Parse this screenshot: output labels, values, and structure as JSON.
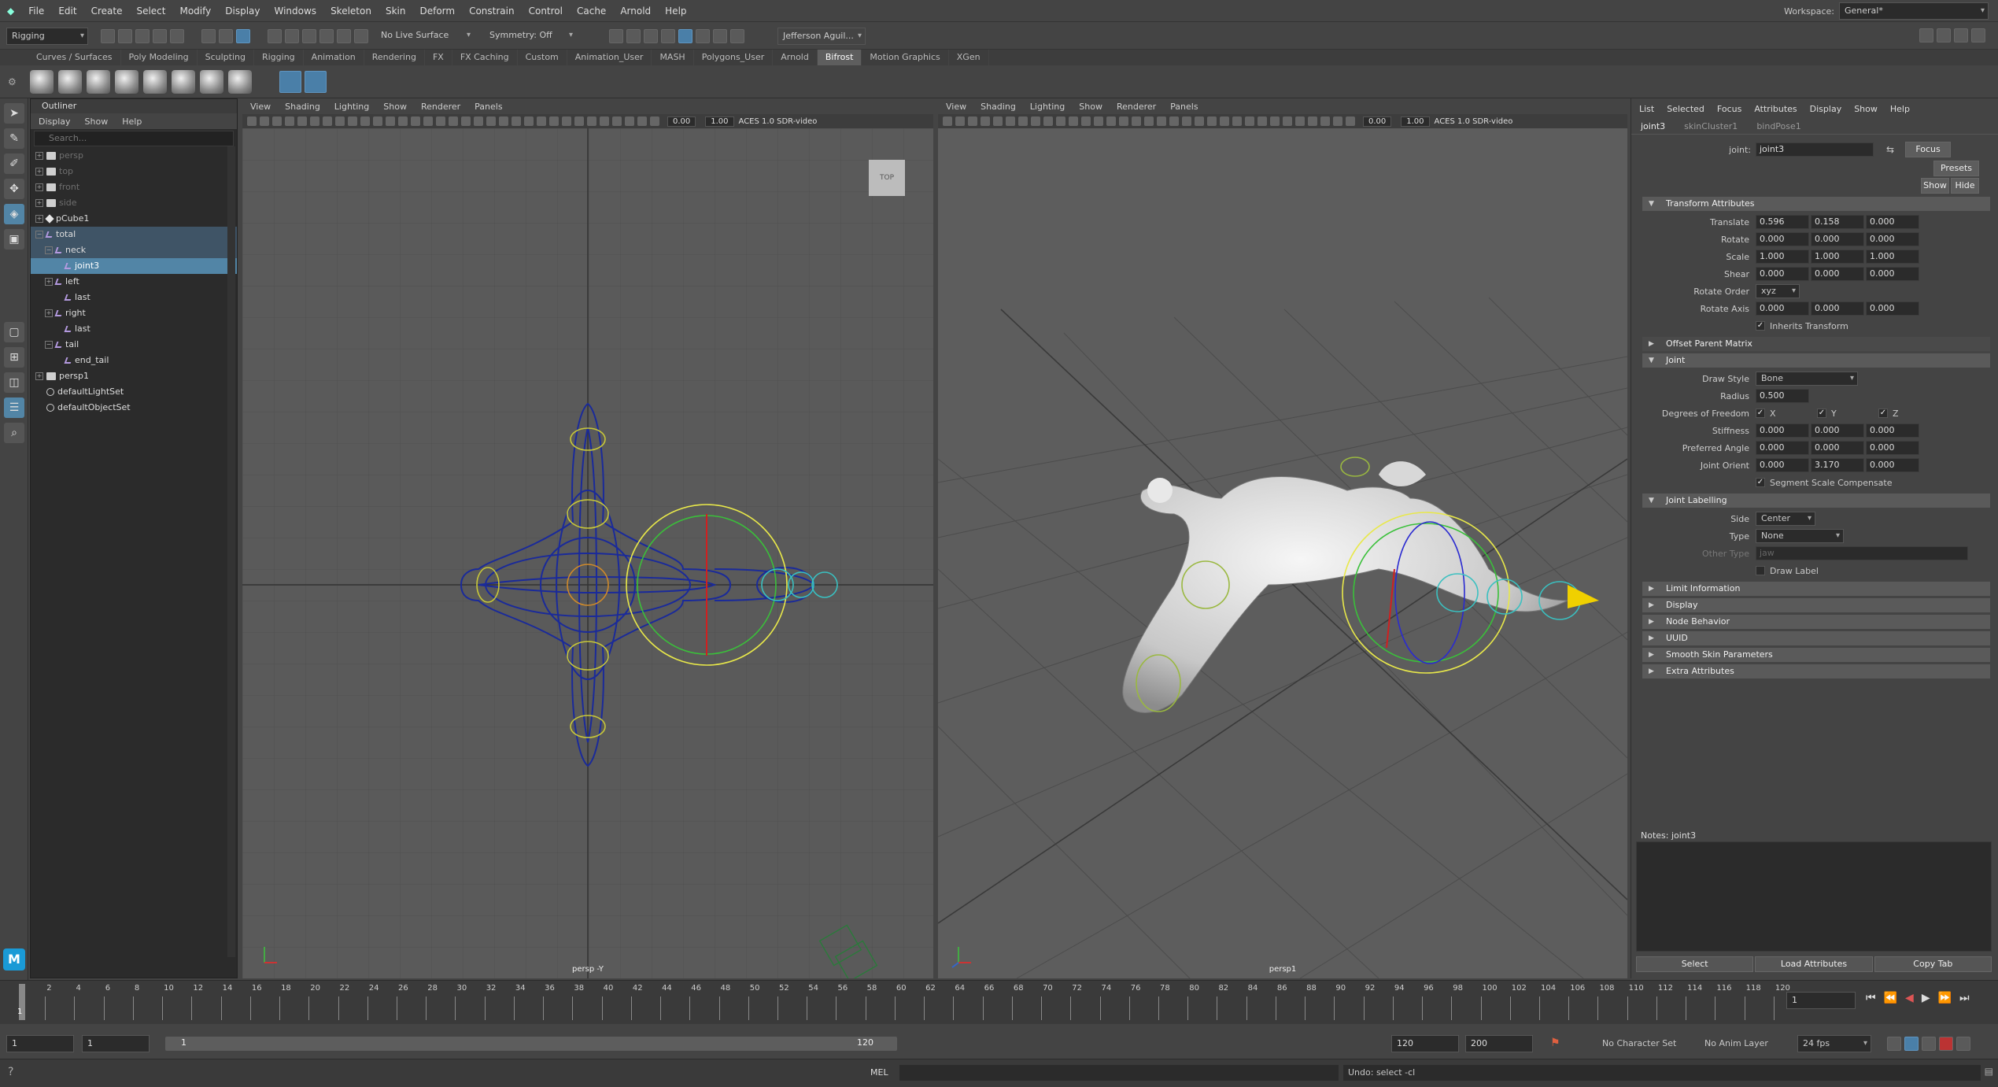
{
  "menubar": {
    "items": [
      "File",
      "Edit",
      "Create",
      "Select",
      "Modify",
      "Display",
      "Windows",
      "Skeleton",
      "Skin",
      "Deform",
      "Constrain",
      "Control",
      "Cache",
      "Arnold",
      "Help"
    ],
    "workspace_label": "Workspace:",
    "workspace_value": "General*"
  },
  "statusline": {
    "menuset": "Rigging",
    "live_surface": "No Live Surface",
    "symmetry": "Symmetry: Off",
    "user": "Jefferson Aguil..."
  },
  "shelf": {
    "tabs": [
      "Curves / Surfaces",
      "Poly Modeling",
      "Sculpting",
      "Rigging",
      "Animation",
      "Rendering",
      "FX",
      "FX Caching",
      "Custom",
      "Animation_User",
      "MASH",
      "Polygons_User",
      "Arnold",
      "Bifrost",
      "Motion Graphics",
      "XGen"
    ],
    "active_tab": "Bifrost"
  },
  "outliner": {
    "title": "Outliner",
    "menu": [
      "Display",
      "Show",
      "Help"
    ],
    "search_placeholder": "Search...",
    "nodes": [
      {
        "label": "persp",
        "type": "cam",
        "indent": 0,
        "dim": true
      },
      {
        "label": "top",
        "type": "cam",
        "indent": 0,
        "dim": true
      },
      {
        "label": "front",
        "type": "cam",
        "indent": 0,
        "dim": true
      },
      {
        "label": "side",
        "type": "cam",
        "indent": 0,
        "dim": true
      },
      {
        "label": "pCube1",
        "type": "mesh",
        "indent": 0,
        "dim": false
      },
      {
        "label": "total",
        "type": "jt",
        "indent": 0,
        "dim": false,
        "state": "sel2"
      },
      {
        "label": "neck",
        "type": "jt",
        "indent": 1,
        "dim": false,
        "state": "sel2"
      },
      {
        "label": "joint3",
        "type": "jt",
        "indent": 2,
        "dim": false,
        "state": "sel"
      },
      {
        "label": "left",
        "type": "jt",
        "indent": 1,
        "dim": false
      },
      {
        "label": "last",
        "type": "jt",
        "indent": 2,
        "dim": false
      },
      {
        "label": "right",
        "type": "jt",
        "indent": 1,
        "dim": false
      },
      {
        "label": "last",
        "type": "jt",
        "indent": 2,
        "dim": false
      },
      {
        "label": "tail",
        "type": "jt",
        "indent": 1,
        "dim": false
      },
      {
        "label": "end_tail",
        "type": "jt",
        "indent": 2,
        "dim": false
      },
      {
        "label": "persp1",
        "type": "cam",
        "indent": 0,
        "dim": false
      },
      {
        "label": "defaultLightSet",
        "type": "set",
        "indent": 0,
        "dim": false
      },
      {
        "label": "defaultObjectSet",
        "type": "set",
        "indent": 0,
        "dim": false
      }
    ]
  },
  "viewport_left": {
    "menu": [
      "View",
      "Shading",
      "Lighting",
      "Show",
      "Renderer",
      "Panels"
    ],
    "exposure": "0.00",
    "gamma": "1.00",
    "colorspace": "ACES 1.0 SDR-video",
    "cube_label": "TOP",
    "camera_label": "persp -Y"
  },
  "viewport_right": {
    "menu": [
      "View",
      "Shading",
      "Lighting",
      "Show",
      "Renderer",
      "Panels"
    ],
    "exposure": "0.00",
    "gamma": "1.00",
    "colorspace": "ACES 1.0 SDR-video",
    "camera_label": "persp1"
  },
  "attribute_editor": {
    "menu": [
      "List",
      "Selected",
      "Focus",
      "Attributes",
      "Display",
      "Show",
      "Help"
    ],
    "tabs": [
      "joint3",
      "skinCluster1",
      "bindPose1"
    ],
    "joint_label": "joint:",
    "joint_name": "joint3",
    "focus_btn": "Focus",
    "presets_btn": "Presets",
    "show_btn": "Show",
    "hide_btn": "Hide",
    "transform_section": "Transform Attributes",
    "translate_label": "Translate",
    "translate": [
      "0.596",
      "0.158",
      "0.000"
    ],
    "rotate_label": "Rotate",
    "rotate": [
      "0.000",
      "0.000",
      "0.000"
    ],
    "scale_label": "Scale",
    "scale": [
      "1.000",
      "1.000",
      "1.000"
    ],
    "shear_label": "Shear",
    "shear": [
      "0.000",
      "0.000",
      "0.000"
    ],
    "rotate_order_label": "Rotate Order",
    "rotate_order": "xyz",
    "rotate_axis_label": "Rotate Axis",
    "rotate_axis": [
      "0.000",
      "0.000",
      "0.000"
    ],
    "inherits_transform": "Inherits Transform",
    "offset_parent_matrix": "Offset Parent Matrix",
    "joint_section": "Joint",
    "draw_style_label": "Draw Style",
    "draw_style": "Bone",
    "radius_label": "Radius",
    "radius": "0.500",
    "dof_label": "Degrees of Freedom",
    "dof": [
      "X",
      "Y",
      "Z"
    ],
    "stiffness_label": "Stiffness",
    "stiffness": [
      "0.000",
      "0.000",
      "0.000"
    ],
    "preferred_angle_label": "Preferred Angle",
    "preferred_angle": [
      "0.000",
      "0.000",
      "0.000"
    ],
    "joint_orient_label": "Joint Orient",
    "joint_orient": [
      "0.000",
      "3.170",
      "0.000"
    ],
    "segment_scale": "Segment Scale Compensate",
    "labelling_section": "Joint Labelling",
    "side_label": "Side",
    "side": "Center",
    "type_label": "Type",
    "type": "None",
    "other_type_label": "Other Type",
    "other_type": "jaw",
    "draw_label": "Draw Label",
    "collapsed_sections": [
      "Limit Information",
      "Display",
      "Node Behavior",
      "UUID",
      "Smooth Skin Parameters",
      "Extra Attributes"
    ],
    "notes_label": "Notes: joint3",
    "select_btn": "Select",
    "load_btn": "Load Attributes",
    "copy_btn": "Copy Tab"
  },
  "timeline": {
    "ticks": [
      "2",
      "4",
      "6",
      "8",
      "10",
      "12",
      "14",
      "16",
      "18",
      "20",
      "22",
      "24",
      "26",
      "28",
      "30",
      "32",
      "34",
      "36",
      "38",
      "40",
      "42",
      "44",
      "46",
      "48",
      "50",
      "52",
      "54",
      "56",
      "58",
      "60",
      "62",
      "64",
      "66",
      "68",
      "70",
      "72",
      "74",
      "76",
      "78",
      "80",
      "82",
      "84",
      "86",
      "88",
      "90",
      "92",
      "94",
      "96",
      "98",
      "100",
      "102",
      "104",
      "106",
      "108",
      "110",
      "112",
      "114",
      "116",
      "118",
      "120"
    ],
    "current_frame": "1",
    "frame_field": "1"
  },
  "range": {
    "start": "1",
    "anim_start": "1",
    "slider_start": "1",
    "slider_end": "120",
    "anim_end": "120",
    "end": "200",
    "character_set": "No Character Set",
    "anim_layer": "No Anim Layer",
    "fps": "24 fps"
  },
  "cmdline": {
    "mode": "MEL",
    "result": "Undo: select -cl"
  }
}
